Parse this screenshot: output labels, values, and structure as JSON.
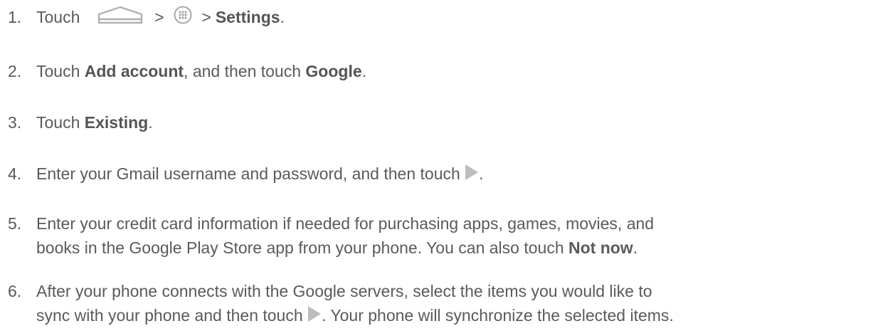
{
  "steps": [
    {
      "number": "1.",
      "touch": "Touch",
      "icon1": "home-icon",
      "gt1": ">",
      "icon2": "apps-grid-icon",
      "gt2": ">",
      "settings": "Settings",
      "end": "."
    },
    {
      "number": "2.",
      "touch": "Touch ",
      "add_account": "Add account",
      "mid": ", and then touch ",
      "google": "Google",
      "end": "."
    },
    {
      "number": "3.",
      "touch": "Touch ",
      "existing": "Existing",
      "end": "."
    },
    {
      "number": "4.",
      "text": "Enter your Gmail username and password, and then touch ",
      "icon": "play-arrow-icon",
      "end": "."
    },
    {
      "number": "5.",
      "line1": "Enter your credit card information if needed for purchasing apps, games, movies, and",
      "line2_pre": "books in the Google Play Store app from your phone. You can also touch ",
      "not_now": "Not now",
      "end": "."
    },
    {
      "number": "6.",
      "line1": "After your phone connects with the Google servers, select the items you would like to",
      "line2_pre": "sync with your phone and then touch ",
      "icon": "play-arrow-icon",
      "line2_post": ". Your phone will synchronize the selected items."
    }
  ],
  "colors": {
    "text": "#5a5a5a",
    "icon": "#bdbdbd"
  }
}
